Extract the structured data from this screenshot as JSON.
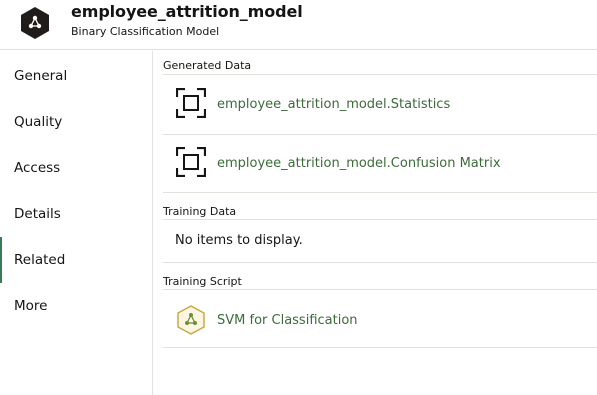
{
  "header": {
    "title": "employee_attrition_model",
    "subtitle": "Binary Classification Model",
    "logo_icon": "model-network-icon"
  },
  "sidebar": {
    "items": [
      {
        "label": "General",
        "active": false
      },
      {
        "label": "Quality",
        "active": false
      },
      {
        "label": "Access",
        "active": false
      },
      {
        "label": "Details",
        "active": false
      },
      {
        "label": "Related",
        "active": true
      },
      {
        "label": "More",
        "active": false
      }
    ]
  },
  "main": {
    "generated": {
      "heading": "Generated Data",
      "items": [
        {
          "label": "employee_attrition_model.Statistics",
          "icon": "frame-icon"
        },
        {
          "label": "employee_attrition_model.Confusion Matrix",
          "icon": "frame-icon"
        }
      ]
    },
    "training_data": {
      "heading": "Training Data",
      "empty_text": "No items to display."
    },
    "training_script": {
      "heading": "Training Script",
      "items": [
        {
          "label": "SVM for Classification",
          "icon": "hexagon-network-icon"
        }
      ]
    }
  },
  "colors": {
    "link": "#3c6b3a",
    "active_indicator": "#3b7a57",
    "logo_bg": "#1f1c1a",
    "border": "#e4e1dd"
  }
}
